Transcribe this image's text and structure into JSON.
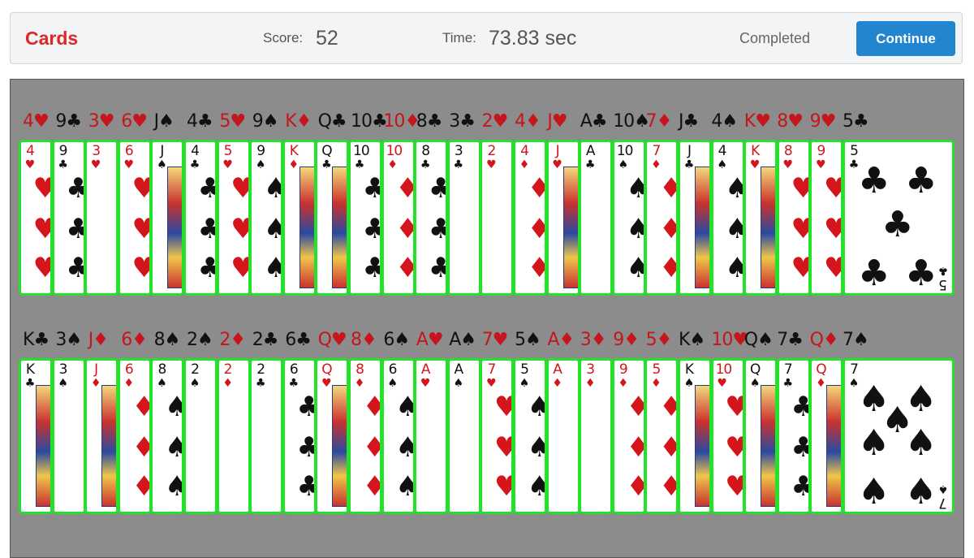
{
  "header": {
    "title": "Cards",
    "score_label": "Score:",
    "score_value": "52",
    "time_label": "Time:",
    "time_value": "73.83 sec",
    "status": "Completed",
    "continue_label": "Continue"
  },
  "colors": {
    "red": "#c4161c",
    "black": "#111111",
    "card_border": "#22e22a",
    "table": "#8c8c8c",
    "accent": "#2185d0"
  },
  "rows": [
    {
      "cards": [
        {
          "rank": "4",
          "suit": "♥"
        },
        {
          "rank": "9",
          "suit": "♣"
        },
        {
          "rank": "3",
          "suit": "♥"
        },
        {
          "rank": "6",
          "suit": "♥"
        },
        {
          "rank": "J",
          "suit": "♠"
        },
        {
          "rank": "4",
          "suit": "♣"
        },
        {
          "rank": "5",
          "suit": "♥"
        },
        {
          "rank": "9",
          "suit": "♠"
        },
        {
          "rank": "K",
          "suit": "♦"
        },
        {
          "rank": "Q",
          "suit": "♣"
        },
        {
          "rank": "10",
          "suit": "♣"
        },
        {
          "rank": "10",
          "suit": "♦"
        },
        {
          "rank": "8",
          "suit": "♣"
        },
        {
          "rank": "3",
          "suit": "♣"
        },
        {
          "rank": "2",
          "suit": "♥"
        },
        {
          "rank": "4",
          "suit": "♦"
        },
        {
          "rank": "J",
          "suit": "♥"
        },
        {
          "rank": "A",
          "suit": "♣"
        },
        {
          "rank": "10",
          "suit": "♠"
        },
        {
          "rank": "7",
          "suit": "♦"
        },
        {
          "rank": "J",
          "suit": "♣"
        },
        {
          "rank": "4",
          "suit": "♠"
        },
        {
          "rank": "K",
          "suit": "♥"
        },
        {
          "rank": "8",
          "suit": "♥"
        },
        {
          "rank": "9",
          "suit": "♥"
        },
        {
          "rank": "5",
          "suit": "♣"
        }
      ]
    },
    {
      "cards": [
        {
          "rank": "K",
          "suit": "♣"
        },
        {
          "rank": "3",
          "suit": "♠"
        },
        {
          "rank": "J",
          "suit": "♦"
        },
        {
          "rank": "6",
          "suit": "♦"
        },
        {
          "rank": "8",
          "suit": "♠"
        },
        {
          "rank": "2",
          "suit": "♠"
        },
        {
          "rank": "2",
          "suit": "♦"
        },
        {
          "rank": "2",
          "suit": "♣"
        },
        {
          "rank": "6",
          "suit": "♣"
        },
        {
          "rank": "Q",
          "suit": "♥"
        },
        {
          "rank": "8",
          "suit": "♦"
        },
        {
          "rank": "6",
          "suit": "♠"
        },
        {
          "rank": "A",
          "suit": "♥"
        },
        {
          "rank": "A",
          "suit": "♠"
        },
        {
          "rank": "7",
          "suit": "♥"
        },
        {
          "rank": "5",
          "suit": "♠"
        },
        {
          "rank": "A",
          "suit": "♦"
        },
        {
          "rank": "3",
          "suit": "♦"
        },
        {
          "rank": "9",
          "suit": "♦"
        },
        {
          "rank": "5",
          "suit": "♦"
        },
        {
          "rank": "K",
          "suit": "♠"
        },
        {
          "rank": "10",
          "suit": "♥"
        },
        {
          "rank": "Q",
          "suit": "♠"
        },
        {
          "rank": "7",
          "suit": "♣"
        },
        {
          "rank": "Q",
          "suit": "♦"
        },
        {
          "rank": "7",
          "suit": "♠"
        }
      ]
    }
  ]
}
